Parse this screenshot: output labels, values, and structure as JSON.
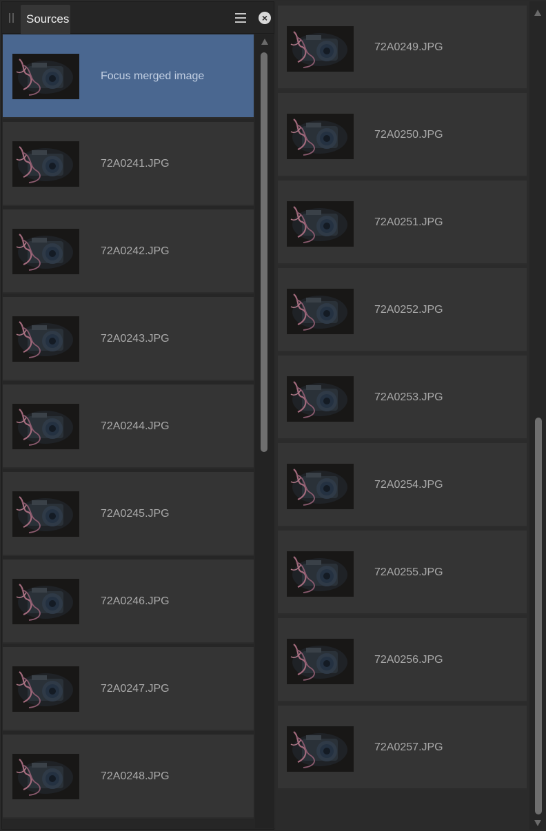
{
  "panel": {
    "tab_label": "Sources",
    "menu_icon": "hamburger-menu-icon",
    "close_icon": "close-circle-icon"
  },
  "left_list": {
    "items": [
      {
        "label": "Focus merged image",
        "selected": true
      },
      {
        "label": "72A0241.JPG",
        "selected": false
      },
      {
        "label": "72A0242.JPG",
        "selected": false
      },
      {
        "label": "72A0243.JPG",
        "selected": false
      },
      {
        "label": "72A0244.JPG",
        "selected": false
      },
      {
        "label": "72A0245.JPG",
        "selected": false
      },
      {
        "label": "72A0246.JPG",
        "selected": false
      },
      {
        "label": "72A0247.JPG",
        "selected": false
      },
      {
        "label": "72A0248.JPG",
        "selected": false
      }
    ]
  },
  "right_list": {
    "items": [
      {
        "label": "72A0249.JPG"
      },
      {
        "label": "72A0250.JPG"
      },
      {
        "label": "72A0251.JPG"
      },
      {
        "label": "72A0252.JPG"
      },
      {
        "label": "72A0253.JPG"
      },
      {
        "label": "72A0254.JPG"
      },
      {
        "label": "72A0255.JPG"
      },
      {
        "label": "72A0256.JPG"
      },
      {
        "label": "72A0257.JPG"
      }
    ]
  },
  "colors": {
    "selected_row": "#4a6790",
    "row": "#343434",
    "label_text": "#a9a9a9"
  }
}
